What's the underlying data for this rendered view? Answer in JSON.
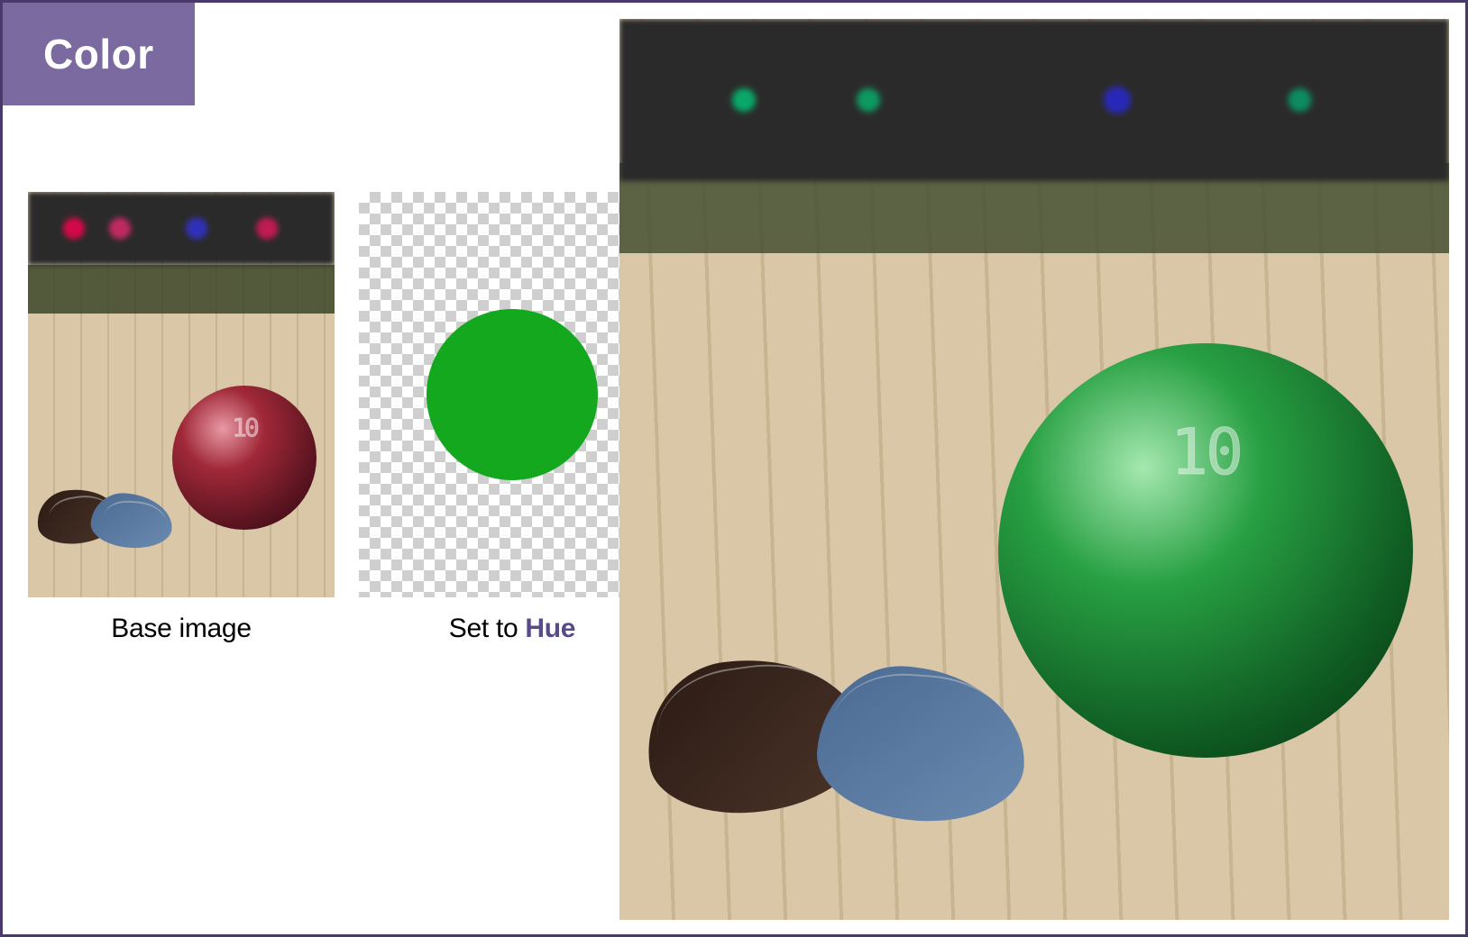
{
  "title": "Color",
  "base": {
    "caption": "Base image",
    "ball_number": "10"
  },
  "overlay": {
    "caption_prefix": "Set to ",
    "mode": "Hue",
    "circle_color": "#13a81e"
  },
  "result": {
    "ball_number": "10"
  }
}
